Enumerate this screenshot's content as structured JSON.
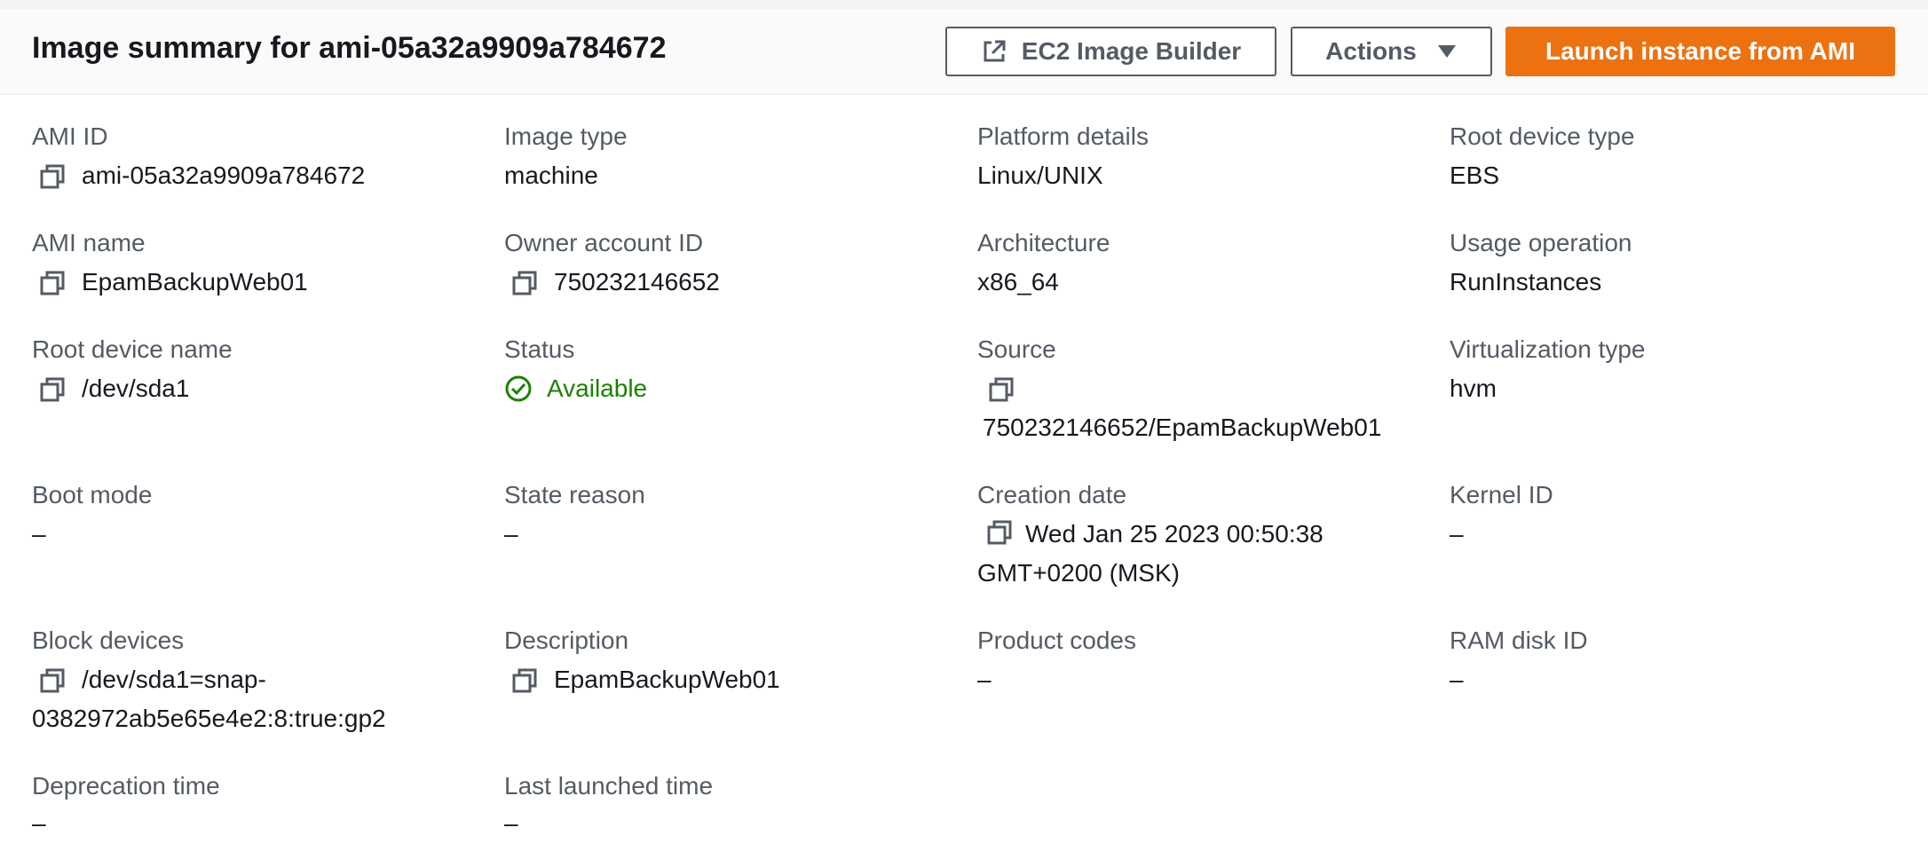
{
  "header": {
    "title": "Image summary for ami-05a32a9909a784672",
    "buttons": {
      "image_builder": "EC2 Image Builder",
      "actions": "Actions",
      "launch": "Launch instance from AMI"
    }
  },
  "details": {
    "ami_id": {
      "label": "AMI ID",
      "value": "ami-05a32a9909a784672"
    },
    "image_type": {
      "label": "Image type",
      "value": "machine"
    },
    "platform_details": {
      "label": "Platform details",
      "value": "Linux/UNIX"
    },
    "root_device_type": {
      "label": "Root device type",
      "value": "EBS"
    },
    "ami_name": {
      "label": "AMI name",
      "value": "EpamBackupWeb01"
    },
    "owner_account_id": {
      "label": "Owner account ID",
      "value": "750232146652"
    },
    "architecture": {
      "label": "Architecture",
      "value": "x86_64"
    },
    "usage_operation": {
      "label": "Usage operation",
      "value": "RunInstances"
    },
    "root_device_name": {
      "label": "Root device name",
      "value": "/dev/sda1"
    },
    "status": {
      "label": "Status",
      "value": "Available"
    },
    "source": {
      "label": "Source",
      "value": "750232146652/EpamBackupWeb01"
    },
    "virtualization_type": {
      "label": "Virtualization type",
      "value": "hvm"
    },
    "boot_mode": {
      "label": "Boot mode",
      "value": "–"
    },
    "state_reason": {
      "label": "State reason",
      "value": "–"
    },
    "creation_date": {
      "label": "Creation date",
      "value_line1": "Wed Jan 25 2023 00:50:38",
      "value_line2": "GMT+0200 (MSK)"
    },
    "kernel_id": {
      "label": "Kernel ID",
      "value": "–"
    },
    "block_devices": {
      "label": "Block devices",
      "value_line1": "/dev/sda1=snap-",
      "value_line2": "0382972ab5e65e4e2:8:true:gp2"
    },
    "description": {
      "label": "Description",
      "value": "EpamBackupWeb01"
    },
    "product_codes": {
      "label": "Product codes",
      "value": "–"
    },
    "ram_disk_id": {
      "label": "RAM disk ID",
      "value": "–"
    },
    "deprecation_time": {
      "label": "Deprecation time",
      "value": "–"
    },
    "last_launched_time": {
      "label": "Last launched time",
      "value": "–"
    }
  },
  "icons": {
    "copy": "copy-icon",
    "external_link": "external-link-icon",
    "caret_down": "caret-down-icon",
    "status_success": "check-circle-icon"
  },
  "colors": {
    "primary_button": "#ec7211",
    "status_success": "#1d8102",
    "label_text": "#545b64",
    "value_text": "#16191f"
  }
}
